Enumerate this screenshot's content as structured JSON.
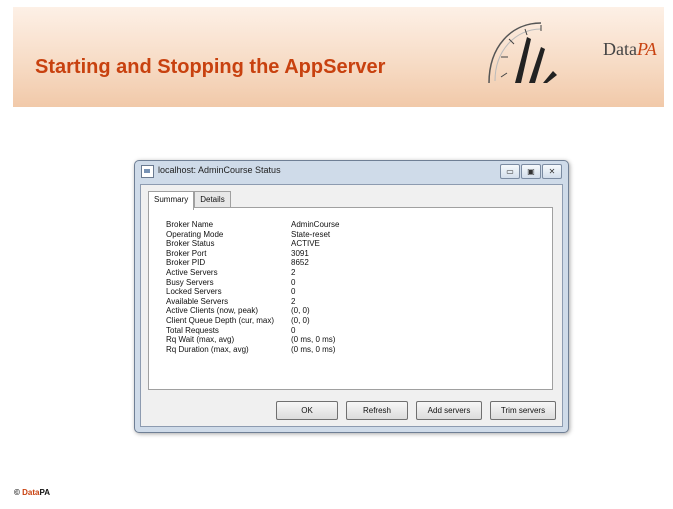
{
  "slide": {
    "title": "Starting and Stopping the AppServer",
    "logo_main": "Data",
    "logo_accent": "PA",
    "footer_symbol": "©",
    "footer_accent": "Data",
    "footer_rest": "PA",
    "accent_color": "#c8410f"
  },
  "window": {
    "title": "localhost: AdminCourse Status",
    "buttons": {
      "minimize": "▭",
      "maximize": "▣",
      "close": "✕"
    },
    "tabs": [
      "Summary",
      "Details"
    ],
    "properties": [
      {
        "label": "Broker Name",
        "value": "AdminCourse"
      },
      {
        "label": "Operating Mode",
        "value": "State-reset"
      },
      {
        "label": "Broker Status",
        "value": "ACTIVE"
      },
      {
        "label": "Broker Port",
        "value": "3091"
      },
      {
        "label": "Broker PID",
        "value": "8652"
      },
      {
        "label": "Active Servers",
        "value": "2"
      },
      {
        "label": "Busy Servers",
        "value": "0"
      },
      {
        "label": "Locked Servers",
        "value": "0"
      },
      {
        "label": "Available Servers",
        "value": "2"
      },
      {
        "label": "Active Clients (now, peak)",
        "value": "(0, 0)"
      },
      {
        "label": "Client Queue Depth (cur, max)",
        "value": "(0, 0)"
      },
      {
        "label": "Total Requests",
        "value": "0"
      },
      {
        "label": "Rq Wait (max, avg)",
        "value": "(0 ms, 0 ms)"
      },
      {
        "label": "Rq Duration (max, avg)",
        "value": "(0 ms, 0 ms)"
      }
    ],
    "actions": {
      "ok": "OK",
      "refresh": "Refresh",
      "add_servers": "Add servers",
      "trim_servers": "Trim servers"
    }
  }
}
